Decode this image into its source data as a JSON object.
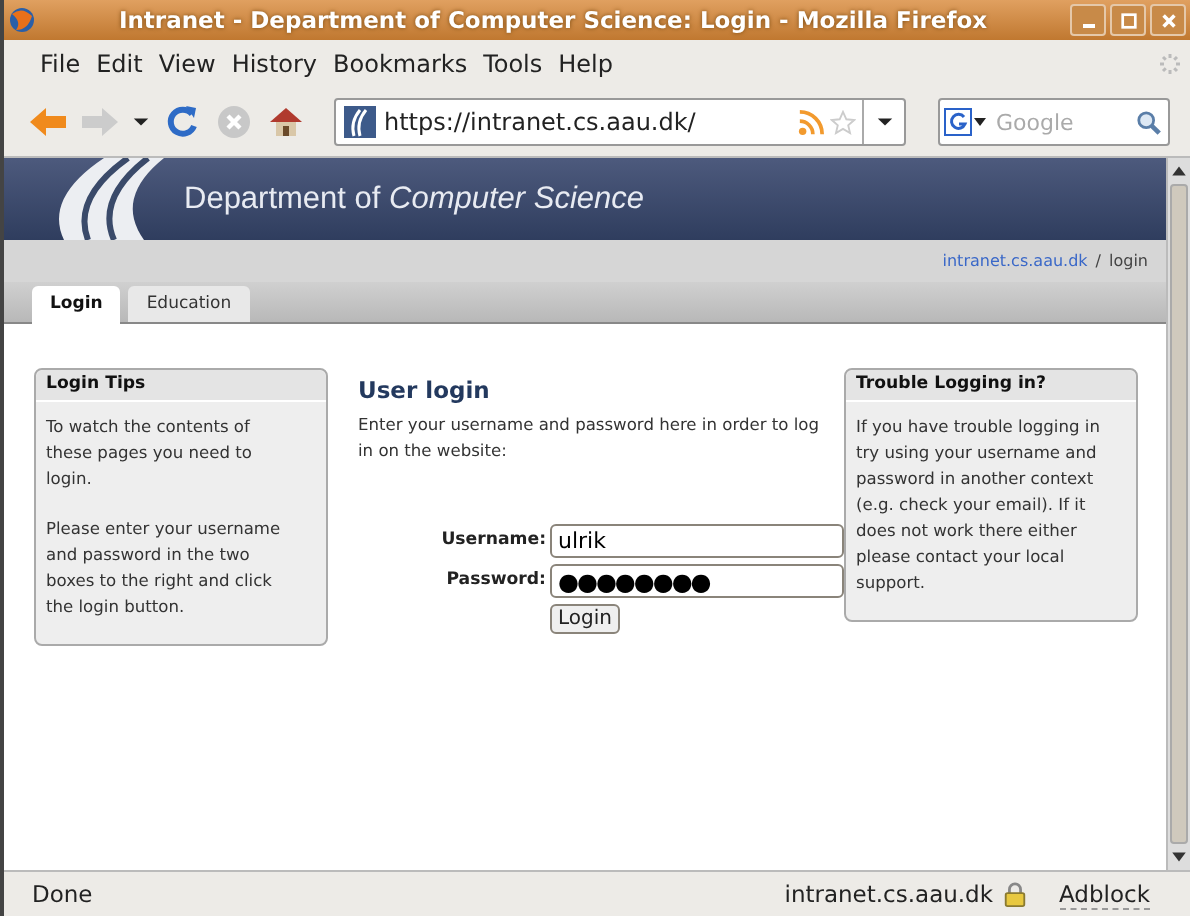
{
  "window": {
    "title": "Intranet - Department of Computer Science: Login - Mozilla Firefox"
  },
  "menu": [
    "File",
    "Edit",
    "View",
    "History",
    "Bookmarks",
    "Tools",
    "Help"
  ],
  "address": {
    "value": "https://intranet.cs.aau.dk/"
  },
  "search": {
    "placeholder": "Google"
  },
  "header": {
    "title_plain": "Department of",
    "title_italic": "Computer Science"
  },
  "breadcrumb": {
    "link": "intranet.cs.aau.dk",
    "separator": "/",
    "current": "login"
  },
  "tabs": [
    {
      "label": "Login",
      "selected": true
    },
    {
      "label": "Education",
      "selected": false
    }
  ],
  "tips": {
    "title": "Login Tips",
    "paragraphs": [
      "To watch the contents of these pages you need to login.",
      "Please enter your username and password in the two boxes to the right and click the login button."
    ]
  },
  "login": {
    "title": "User login",
    "intro": "Enter your username and password here in order to log in on the website:",
    "username_label": "Username:",
    "username": "ulrik",
    "password_label": "Password:",
    "password": "●●●●●●●●",
    "button": "Login"
  },
  "trouble": {
    "title": "Trouble Logging in?",
    "text": "If you have trouble logging in try using your username and password in another context (e.g. check your email). If it does not work there either please contact your local support."
  },
  "status_bar": {
    "text": "Done",
    "host": "intranet.cs.aau.dk",
    "addon": "Adblock"
  }
}
